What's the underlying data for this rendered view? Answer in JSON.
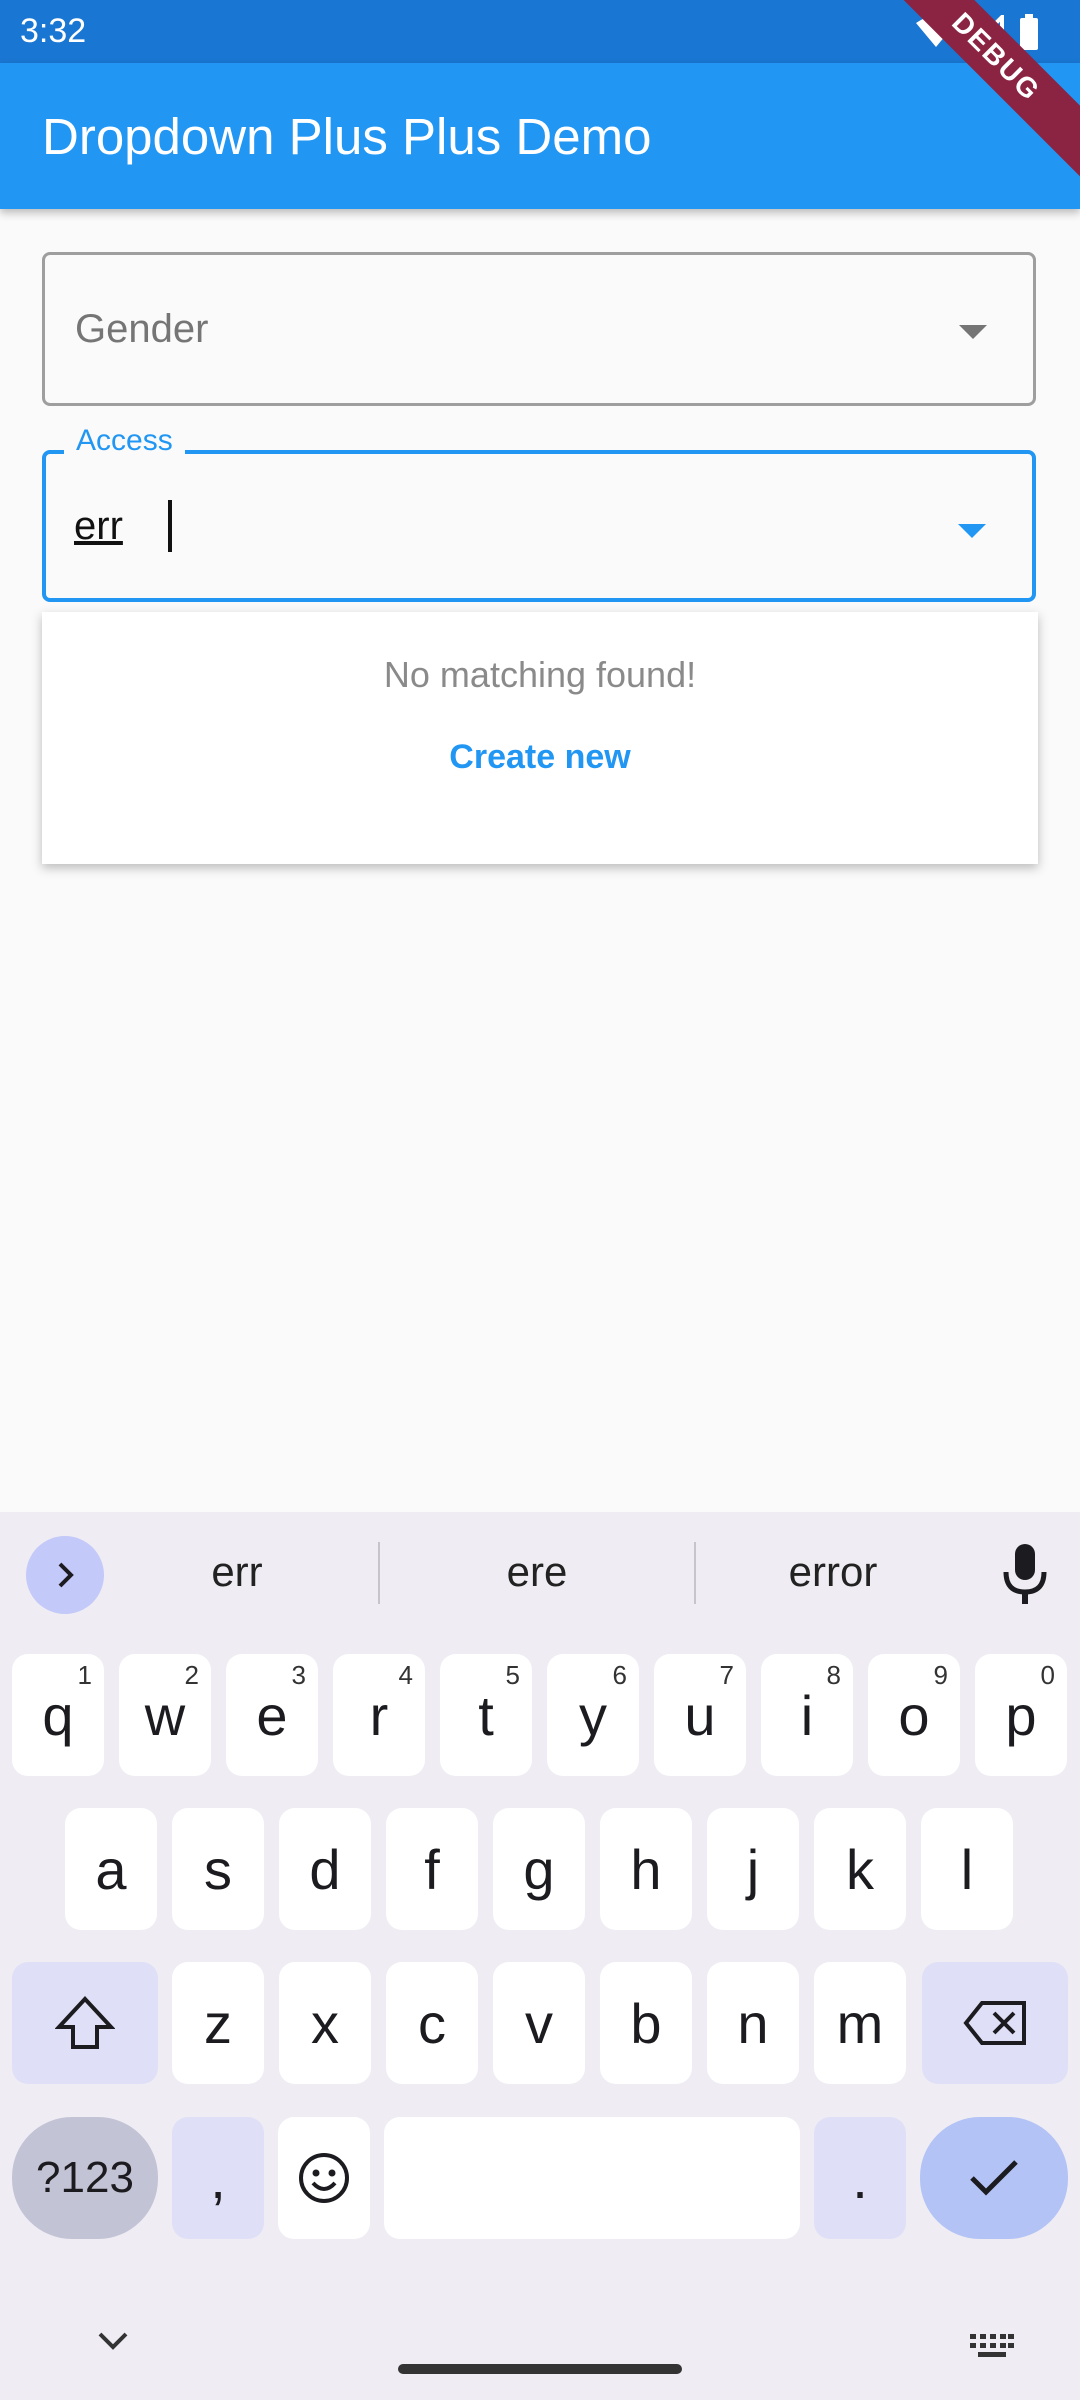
{
  "status": {
    "time": "3:32"
  },
  "appbar": {
    "title": "Dropdown Plus Plus Demo",
    "debug_label": "DEBUG"
  },
  "gender_field": {
    "placeholder": "Gender"
  },
  "access_field": {
    "label": "Access",
    "value": "err"
  },
  "popup": {
    "message": "No matching found!",
    "action": "Create new"
  },
  "keyboard": {
    "suggestions": [
      "err",
      "ere",
      "error"
    ],
    "row1": [
      {
        "key": "q",
        "hint": "1"
      },
      {
        "key": "w",
        "hint": "2"
      },
      {
        "key": "e",
        "hint": "3"
      },
      {
        "key": "r",
        "hint": "4"
      },
      {
        "key": "t",
        "hint": "5"
      },
      {
        "key": "y",
        "hint": "6"
      },
      {
        "key": "u",
        "hint": "7"
      },
      {
        "key": "i",
        "hint": "8"
      },
      {
        "key": "o",
        "hint": "9"
      },
      {
        "key": "p",
        "hint": "0"
      }
    ],
    "row2": [
      "a",
      "s",
      "d",
      "f",
      "g",
      "h",
      "j",
      "k",
      "l"
    ],
    "row3": [
      "z",
      "x",
      "c",
      "v",
      "b",
      "n",
      "m"
    ],
    "symbols_key": "?123",
    "comma_key": ",",
    "period_key": "."
  },
  "colors": {
    "primary": "#2196f3",
    "statusbar": "#1976d2",
    "debug": "#8b2342"
  },
  "icons": [
    "wifi-icon",
    "signal-icon",
    "battery-icon",
    "dropdown-arrow-icon",
    "chevron-right-icon",
    "mic-icon",
    "shift-icon",
    "backspace-icon",
    "emoji-icon",
    "check-icon",
    "chevron-down-icon",
    "keyboard-icon"
  ]
}
